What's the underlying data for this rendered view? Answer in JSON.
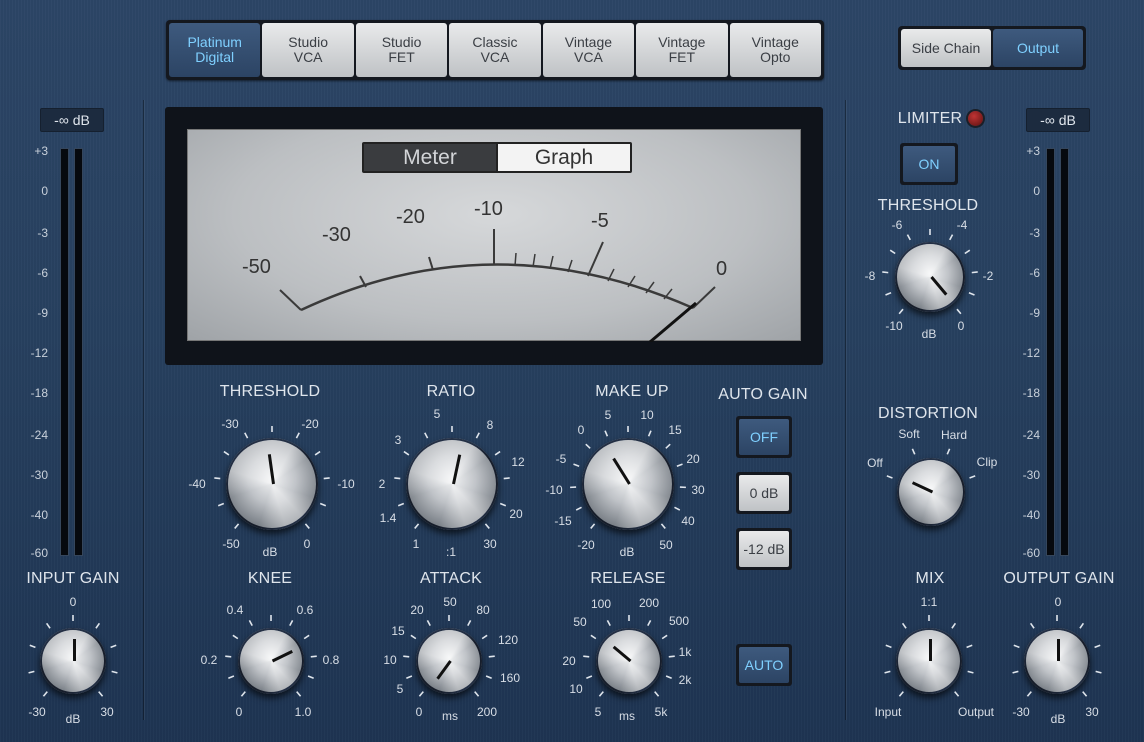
{
  "models": [
    "Platinum\nDigital",
    "Studio\nVCA",
    "Studio\nFET",
    "Classic\nVCA",
    "Vintage\nVCA",
    "Vintage\nFET",
    "Vintage\nOpto"
  ],
  "view_buttons": {
    "side_chain": "Side Chain",
    "output": "Output"
  },
  "input_meter": {
    "readout": "-∞ dB",
    "scale": [
      "+3",
      "0",
      "-3",
      "-6",
      "-9",
      "-12",
      "-18",
      "-24",
      "-30",
      "-40",
      "-60"
    ]
  },
  "output_meter": {
    "readout": "-∞ dB",
    "scale": [
      "+3",
      "0",
      "-3",
      "-6",
      "-9",
      "-12",
      "-18",
      "-24",
      "-30",
      "-40",
      "-60"
    ]
  },
  "display": {
    "tabs": {
      "meter": "Meter",
      "graph": "Graph"
    },
    "scale_labels": [
      "-50",
      "-30",
      "-20",
      "-10",
      "-5",
      "0"
    ]
  },
  "threshold": {
    "label": "THRESHOLD",
    "ticks": [
      "-30",
      "-20",
      "-10",
      "0",
      "-50",
      "-40"
    ],
    "unit": "dB"
  },
  "ratio": {
    "label": "RATIO",
    "ticks": [
      "5",
      "8",
      "12",
      "20",
      "30",
      "1",
      "1.4",
      "2",
      "3"
    ],
    "unit": ":1"
  },
  "makeup": {
    "label": "MAKE UP",
    "ticks": [
      "0",
      "5",
      "10",
      "15",
      "20",
      "30",
      "40",
      "50",
      "-20",
      "-15",
      "-10",
      "-5"
    ],
    "unit": "dB"
  },
  "auto_gain": {
    "label": "AUTO GAIN",
    "off": "OFF",
    "zero": "0 dB",
    "minus12": "-12 dB"
  },
  "knee": {
    "label": "KNEE",
    "ticks": [
      "0.4",
      "0.6",
      "0.8",
      "1.0",
      "0",
      "0.2"
    ]
  },
  "attack": {
    "label": "ATTACK",
    "ticks": [
      "20",
      "50",
      "80",
      "120",
      "160",
      "200",
      "0",
      "5",
      "10",
      "15"
    ],
    "unit": "ms"
  },
  "release": {
    "label": "RELEASE",
    "ticks": [
      "100",
      "200",
      "500",
      "1k",
      "2k",
      "5k",
      "5",
      "10",
      "20",
      "50"
    ],
    "unit": "ms"
  },
  "auto_release": "AUTO",
  "input_gain": {
    "label": "INPUT GAIN",
    "top": "0",
    "min": "-30",
    "max": "30",
    "unit": "dB"
  },
  "output_gain": {
    "label": "OUTPUT GAIN",
    "top": "0",
    "min": "-30",
    "max": "30",
    "unit": "dB"
  },
  "limiter": {
    "label": "LIMITER",
    "button": "ON"
  },
  "limiter_threshold": {
    "label": "THRESHOLD",
    "ticks": [
      "-6",
      "-4",
      "-2",
      "0",
      "-10",
      "-8"
    ],
    "unit": "dB"
  },
  "distortion": {
    "label": "DISTORTION",
    "off": "Off",
    "soft": "Soft",
    "hard": "Hard",
    "clip": "Clip"
  },
  "mix": {
    "label": "MIX",
    "top": "1:1",
    "left": "Input",
    "right": "Output"
  },
  "colors": {
    "accent": "#7fd0ff",
    "panel": "#2a4363",
    "led": "#8b1b1b"
  }
}
